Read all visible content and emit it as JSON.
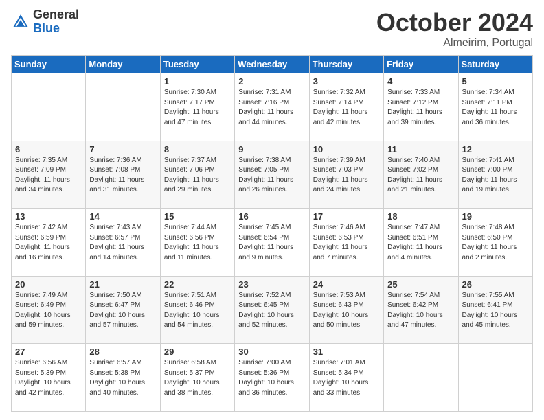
{
  "header": {
    "logo_general": "General",
    "logo_blue": "Blue",
    "month_title": "October 2024",
    "subtitle": "Almeirim, Portugal"
  },
  "days_of_week": [
    "Sunday",
    "Monday",
    "Tuesday",
    "Wednesday",
    "Thursday",
    "Friday",
    "Saturday"
  ],
  "weeks": [
    [
      {
        "day": "",
        "sunrise": "",
        "sunset": "",
        "daylight": ""
      },
      {
        "day": "",
        "sunrise": "",
        "sunset": "",
        "daylight": ""
      },
      {
        "day": "1",
        "sunrise": "Sunrise: 7:30 AM",
        "sunset": "Sunset: 7:17 PM",
        "daylight": "Daylight: 11 hours and 47 minutes."
      },
      {
        "day": "2",
        "sunrise": "Sunrise: 7:31 AM",
        "sunset": "Sunset: 7:16 PM",
        "daylight": "Daylight: 11 hours and 44 minutes."
      },
      {
        "day": "3",
        "sunrise": "Sunrise: 7:32 AM",
        "sunset": "Sunset: 7:14 PM",
        "daylight": "Daylight: 11 hours and 42 minutes."
      },
      {
        "day": "4",
        "sunrise": "Sunrise: 7:33 AM",
        "sunset": "Sunset: 7:12 PM",
        "daylight": "Daylight: 11 hours and 39 minutes."
      },
      {
        "day": "5",
        "sunrise": "Sunrise: 7:34 AM",
        "sunset": "Sunset: 7:11 PM",
        "daylight": "Daylight: 11 hours and 36 minutes."
      }
    ],
    [
      {
        "day": "6",
        "sunrise": "Sunrise: 7:35 AM",
        "sunset": "Sunset: 7:09 PM",
        "daylight": "Daylight: 11 hours and 34 minutes."
      },
      {
        "day": "7",
        "sunrise": "Sunrise: 7:36 AM",
        "sunset": "Sunset: 7:08 PM",
        "daylight": "Daylight: 11 hours and 31 minutes."
      },
      {
        "day": "8",
        "sunrise": "Sunrise: 7:37 AM",
        "sunset": "Sunset: 7:06 PM",
        "daylight": "Daylight: 11 hours and 29 minutes."
      },
      {
        "day": "9",
        "sunrise": "Sunrise: 7:38 AM",
        "sunset": "Sunset: 7:05 PM",
        "daylight": "Daylight: 11 hours and 26 minutes."
      },
      {
        "day": "10",
        "sunrise": "Sunrise: 7:39 AM",
        "sunset": "Sunset: 7:03 PM",
        "daylight": "Daylight: 11 hours and 24 minutes."
      },
      {
        "day": "11",
        "sunrise": "Sunrise: 7:40 AM",
        "sunset": "Sunset: 7:02 PM",
        "daylight": "Daylight: 11 hours and 21 minutes."
      },
      {
        "day": "12",
        "sunrise": "Sunrise: 7:41 AM",
        "sunset": "Sunset: 7:00 PM",
        "daylight": "Daylight: 11 hours and 19 minutes."
      }
    ],
    [
      {
        "day": "13",
        "sunrise": "Sunrise: 7:42 AM",
        "sunset": "Sunset: 6:59 PM",
        "daylight": "Daylight: 11 hours and 16 minutes."
      },
      {
        "day": "14",
        "sunrise": "Sunrise: 7:43 AM",
        "sunset": "Sunset: 6:57 PM",
        "daylight": "Daylight: 11 hours and 14 minutes."
      },
      {
        "day": "15",
        "sunrise": "Sunrise: 7:44 AM",
        "sunset": "Sunset: 6:56 PM",
        "daylight": "Daylight: 11 hours and 11 minutes."
      },
      {
        "day": "16",
        "sunrise": "Sunrise: 7:45 AM",
        "sunset": "Sunset: 6:54 PM",
        "daylight": "Daylight: 11 hours and 9 minutes."
      },
      {
        "day": "17",
        "sunrise": "Sunrise: 7:46 AM",
        "sunset": "Sunset: 6:53 PM",
        "daylight": "Daylight: 11 hours and 7 minutes."
      },
      {
        "day": "18",
        "sunrise": "Sunrise: 7:47 AM",
        "sunset": "Sunset: 6:51 PM",
        "daylight": "Daylight: 11 hours and 4 minutes."
      },
      {
        "day": "19",
        "sunrise": "Sunrise: 7:48 AM",
        "sunset": "Sunset: 6:50 PM",
        "daylight": "Daylight: 11 hours and 2 minutes."
      }
    ],
    [
      {
        "day": "20",
        "sunrise": "Sunrise: 7:49 AM",
        "sunset": "Sunset: 6:49 PM",
        "daylight": "Daylight: 10 hours and 59 minutes."
      },
      {
        "day": "21",
        "sunrise": "Sunrise: 7:50 AM",
        "sunset": "Sunset: 6:47 PM",
        "daylight": "Daylight: 10 hours and 57 minutes."
      },
      {
        "day": "22",
        "sunrise": "Sunrise: 7:51 AM",
        "sunset": "Sunset: 6:46 PM",
        "daylight": "Daylight: 10 hours and 54 minutes."
      },
      {
        "day": "23",
        "sunrise": "Sunrise: 7:52 AM",
        "sunset": "Sunset: 6:45 PM",
        "daylight": "Daylight: 10 hours and 52 minutes."
      },
      {
        "day": "24",
        "sunrise": "Sunrise: 7:53 AM",
        "sunset": "Sunset: 6:43 PM",
        "daylight": "Daylight: 10 hours and 50 minutes."
      },
      {
        "day": "25",
        "sunrise": "Sunrise: 7:54 AM",
        "sunset": "Sunset: 6:42 PM",
        "daylight": "Daylight: 10 hours and 47 minutes."
      },
      {
        "day": "26",
        "sunrise": "Sunrise: 7:55 AM",
        "sunset": "Sunset: 6:41 PM",
        "daylight": "Daylight: 10 hours and 45 minutes."
      }
    ],
    [
      {
        "day": "27",
        "sunrise": "Sunrise: 6:56 AM",
        "sunset": "Sunset: 5:39 PM",
        "daylight": "Daylight: 10 hours and 42 minutes."
      },
      {
        "day": "28",
        "sunrise": "Sunrise: 6:57 AM",
        "sunset": "Sunset: 5:38 PM",
        "daylight": "Daylight: 10 hours and 40 minutes."
      },
      {
        "day": "29",
        "sunrise": "Sunrise: 6:58 AM",
        "sunset": "Sunset: 5:37 PM",
        "daylight": "Daylight: 10 hours and 38 minutes."
      },
      {
        "day": "30",
        "sunrise": "Sunrise: 7:00 AM",
        "sunset": "Sunset: 5:36 PM",
        "daylight": "Daylight: 10 hours and 36 minutes."
      },
      {
        "day": "31",
        "sunrise": "Sunrise: 7:01 AM",
        "sunset": "Sunset: 5:34 PM",
        "daylight": "Daylight: 10 hours and 33 minutes."
      },
      {
        "day": "",
        "sunrise": "",
        "sunset": "",
        "daylight": ""
      },
      {
        "day": "",
        "sunrise": "",
        "sunset": "",
        "daylight": ""
      }
    ]
  ]
}
